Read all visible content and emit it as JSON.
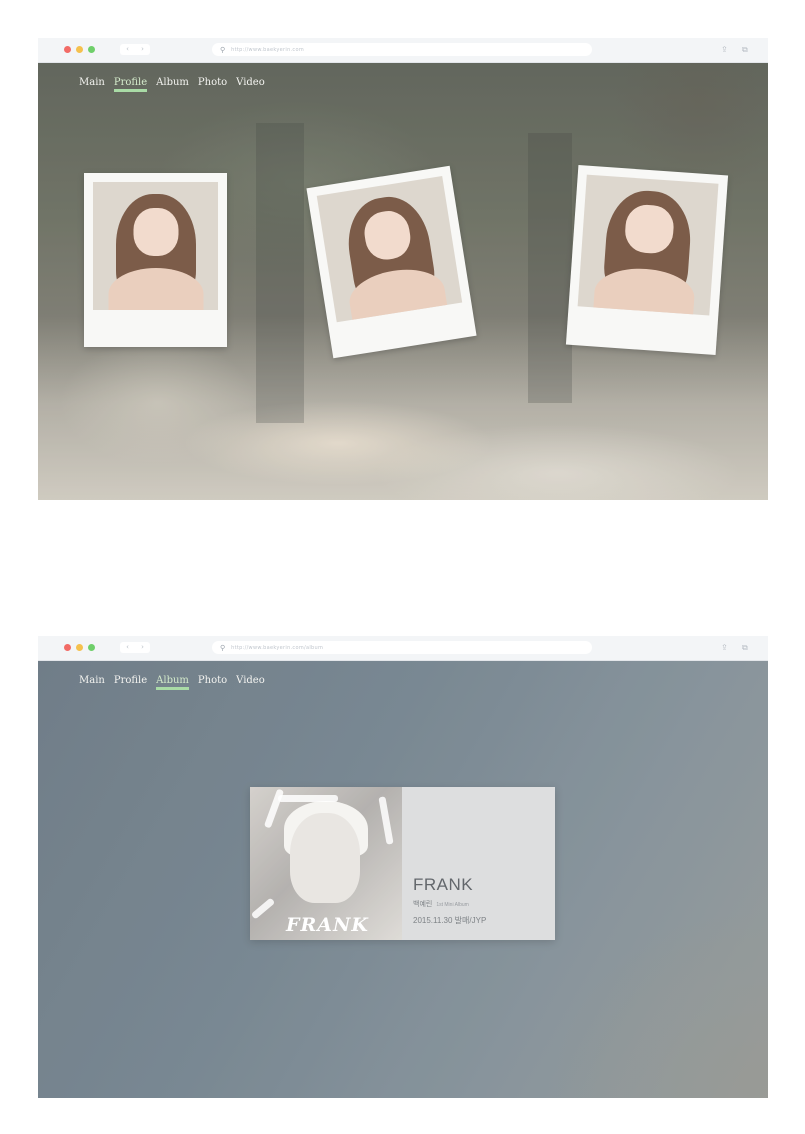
{
  "browser": {
    "nav_buttons": [
      "‹",
      "›"
    ],
    "search_icon": "search-icon",
    "share_icon": "share-icon",
    "tabs_icon": "tabs-icon"
  },
  "screen1": {
    "url": "http://www.baekyerin.com",
    "nav": [
      {
        "label": "Main",
        "active": false
      },
      {
        "label": "Profile",
        "active": true
      },
      {
        "label": "Album",
        "active": false
      },
      {
        "label": "Photo",
        "active": false
      },
      {
        "label": "Video",
        "active": false
      }
    ]
  },
  "screen2": {
    "url": "http://www.baekyerin.com/album",
    "nav": [
      {
        "label": "Main",
        "active": false
      },
      {
        "label": "Profile",
        "active": false
      },
      {
        "label": "Album",
        "active": true
      },
      {
        "label": "Photo",
        "active": false
      },
      {
        "label": "Video",
        "active": false
      }
    ],
    "album": {
      "cover_text": "FRANK",
      "title": "FRANK",
      "artist": "백예린",
      "artist_sub": "1st Mini Album",
      "release": "2015.11.30 발매/JYP"
    }
  },
  "colors": {
    "active_nav_underline": "#9ed69a",
    "info_panel": "#d9dadb"
  }
}
